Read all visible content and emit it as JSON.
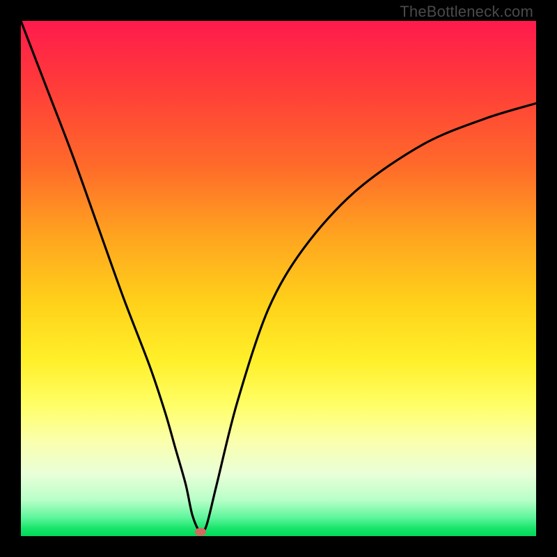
{
  "watermark": "TheBottleneck.com",
  "chart_data": {
    "type": "line",
    "title": "",
    "xlabel": "",
    "ylabel": "",
    "xlim": [
      0,
      100
    ],
    "ylim": [
      0,
      100
    ],
    "series": [
      {
        "name": "bottleneck-curve",
        "x": [
          0,
          5,
          10,
          15,
          20,
          25,
          28,
          30,
          32,
          33.3,
          34.8,
          36,
          38,
          42,
          48,
          55,
          65,
          78,
          90,
          100
        ],
        "values": [
          100,
          87,
          74,
          60,
          46,
          33,
          24,
          17,
          10,
          4,
          0.8,
          2,
          10,
          26,
          44,
          56,
          67,
          76,
          81,
          84
        ]
      }
    ],
    "marker": {
      "x": 34.8,
      "y": 0.8,
      "color": "#d2695f"
    },
    "gradient_stops": [
      {
        "pct": 0,
        "color": "#ff1a4d"
      },
      {
        "pct": 50,
        "color": "#ffd21a"
      },
      {
        "pct": 100,
        "color": "#00d85a"
      }
    ]
  }
}
